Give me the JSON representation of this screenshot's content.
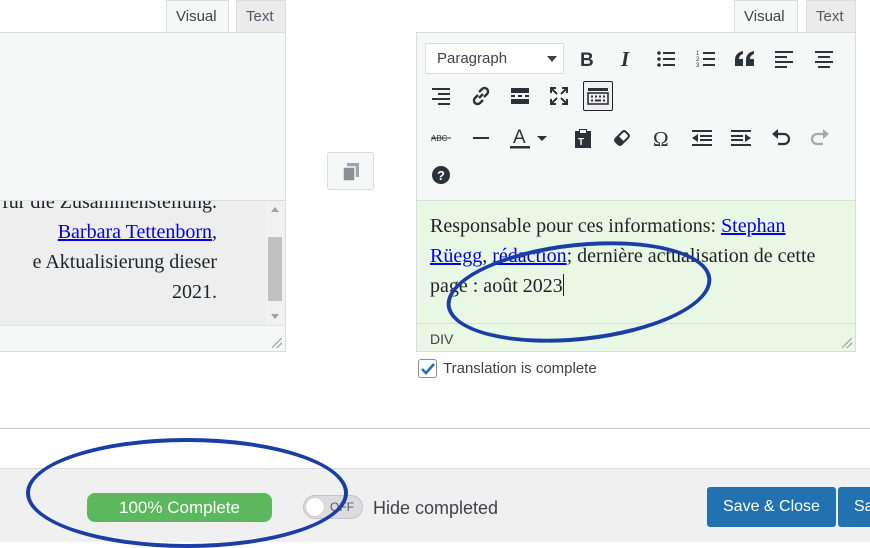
{
  "left_editor": {
    "tabs": [
      {
        "label": "Visual"
      },
      {
        "label": "Text"
      }
    ],
    "content_lines": [
      {
        "pre": "für die Zusammenstellung.",
        "link": "",
        "post": ""
      },
      {
        "pre": "",
        "link": "Barbara Tettenborn",
        "post": ","
      },
      {
        "pre": "e Aktualisierung dieser",
        "link": "",
        "post": ""
      },
      {
        "pre": "2021.",
        "link": "",
        "post": ""
      }
    ]
  },
  "copy_button": {
    "icon": "copy-icon"
  },
  "right_editor": {
    "tabs": [
      {
        "label": "Visual"
      },
      {
        "label": "Text"
      }
    ],
    "format_select": {
      "value": "Paragraph"
    },
    "toolbar_row1": [
      "bold-icon",
      "italic-icon",
      "bulleted-list-icon",
      "numbered-list-icon",
      "blockquote-icon",
      "align-left-icon",
      "align-center-icon"
    ],
    "toolbar_row2": [
      "align-right-icon",
      "link-icon",
      "read-more-icon",
      "fullscreen-icon",
      "toolbar-toggle-icon"
    ],
    "toolbar_row3": [
      "strikethrough-icon",
      "horizontal-line-icon",
      "text-color-icon",
      "paste-text-icon",
      "clear-formatting-icon",
      "special-character-icon",
      "outdent-icon",
      "indent-icon",
      "undo-icon",
      "redo-icon"
    ],
    "toolbar_row4": [
      "help-icon"
    ],
    "content": {
      "text1": "Responsable pour ces informations: ",
      "link1": "Stephan Rüegg",
      "sep": ", ",
      "link2": "rédaction",
      "text2": "; dernière actualisation de cette page : août 2023"
    },
    "status_path": "DIV"
  },
  "translation_complete": {
    "label": "Translation is complete",
    "checked": true
  },
  "footer": {
    "progress": {
      "label": "100% Complete",
      "percent": 100,
      "color": "#5cb85c"
    },
    "toggle": {
      "state_label": "OFF",
      "label": "Hide completed"
    },
    "save_close_label": "Save & Close",
    "save_label_partial": "Sa"
  },
  "colors": {
    "primary": "#2271b1",
    "annotation": "#1a3ea5",
    "translation_bg": "#e8f8e4"
  }
}
